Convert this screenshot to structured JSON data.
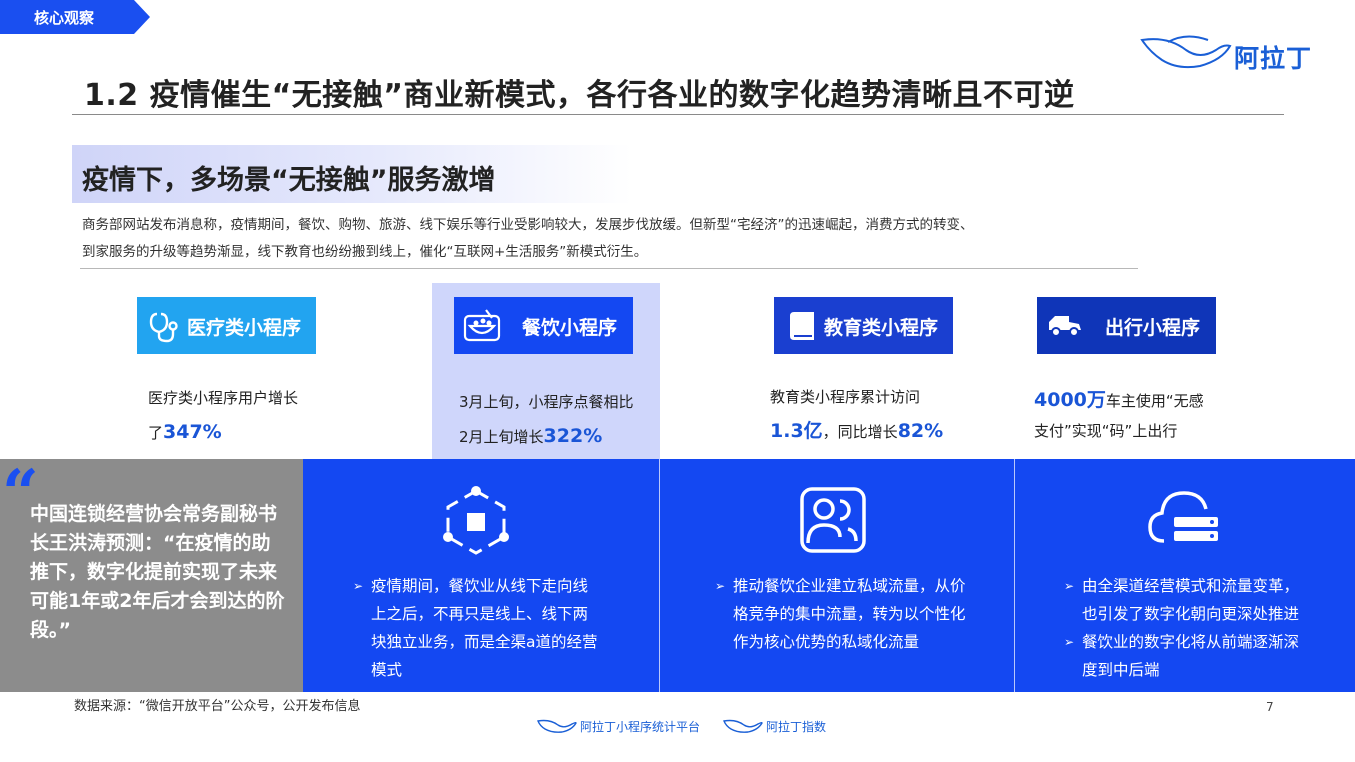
{
  "header": {
    "section_tag": "核心观察",
    "logo_text": "阿拉丁",
    "title": "1.2 疫情催生“无接触”商业新模式，各行各业的数字化趋势清晰且不可逆"
  },
  "subtitle": "疫情下，多场景“无接触”服务激增",
  "intro": {
    "line1": "商务部网站发布消息称，疫情期间，餐饮、购物、旅游、线下娱乐等行业受影响较大，发展步伐放缓。但新型“宅经济”的迅速崛起，消费方式的转变、",
    "line2": "到家服务的升级等趋势渐显，线下教育也纷纷搬到线上，催化“互联网+生活服务”新模式衍生。"
  },
  "categories": [
    {
      "label": "医疗类小程序",
      "icon": "stethoscope-icon",
      "color": "#22a4f0",
      "stat_pre": "医疗类小程序用户增长",
      "stat_line2_pre": "了",
      "stat_value": "347%"
    },
    {
      "label": "餐饮小程序",
      "icon": "food-bowl-icon",
      "color": "#1448f2",
      "stat_pre": "3月上旬，小程序点餐相比",
      "stat_line2_pre": "2月上旬增长",
      "stat_value": "322%"
    },
    {
      "label": "教育类小程序",
      "icon": "book-icon",
      "color": "#1a3fd0",
      "stat_pre": "教育类小程序累计访问",
      "stat_value_a": "1.3亿",
      "stat_mid": "，同比增长",
      "stat_value_b": "82%"
    },
    {
      "label": "出行小程序",
      "icon": "car-icon",
      "color": "#0f35b8",
      "stat_value": "4000万",
      "stat_post": "车主使用“无感",
      "stat_line2": "支付”实现“码”上出行"
    }
  ],
  "quote": {
    "mark": "“",
    "text": "中国连锁经营协会常务副秘书长王洪涛预测：“在疫情的助推下，数字化提前实现了未来可能1年或2年后才会到达的阶段。”"
  },
  "panels": [
    {
      "icon": "hexagon-network-icon",
      "bullets": [
        "疫情期间，餐饮业从线下走向线上之后，不再只是线上、线下两块独立业务，而是全渠a道的经营模式"
      ]
    },
    {
      "icon": "user-group-icon",
      "bullets": [
        "推动餐饮企业建立私域流量，从价格竞争的集中流量，转为以个性化作为核心优势的私域化流量"
      ]
    },
    {
      "icon": "cloud-server-icon",
      "bullets": [
        "由全渠道经营模式和流量变革，也引发了数字化朝向更深处推进",
        "餐饮业的数字化将从前端逐渐深度到中后端"
      ]
    }
  ],
  "footer": {
    "source": "数据来源：“微信开放平台”公众号，公开发布信息",
    "page_number": "7",
    "logo1": "阿拉丁小程序统计平台",
    "logo2": "阿拉丁指数"
  }
}
